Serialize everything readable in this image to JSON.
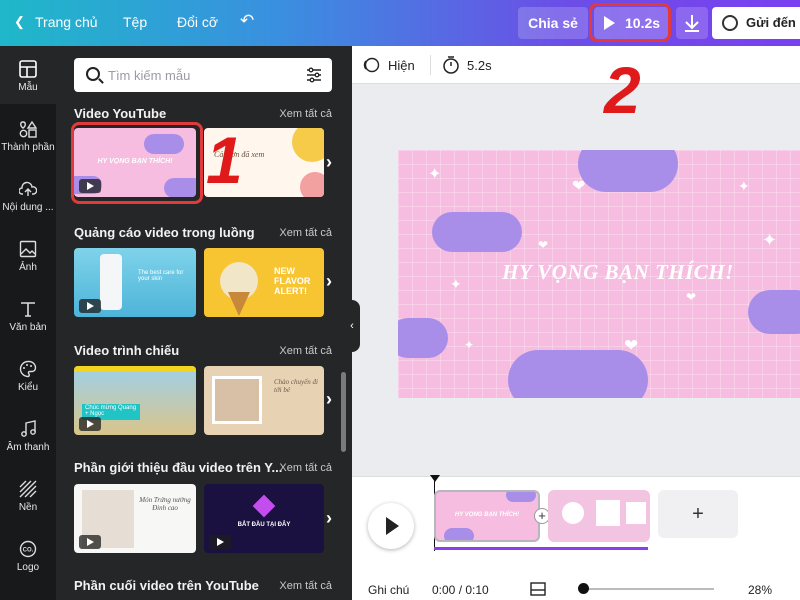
{
  "header": {
    "home": "Trang chủ",
    "file": "Tệp",
    "resize": "Đổi cỡ",
    "share": "Chia sẻ",
    "play_duration": "10.2s",
    "send": "Gửi đến g"
  },
  "nav": [
    {
      "label": "Mẫu",
      "icon": "layout-icon"
    },
    {
      "label": "Thành phần",
      "icon": "shapes-icon"
    },
    {
      "label": "Nội dung ...",
      "icon": "cloud-upload-icon"
    },
    {
      "label": "Ảnh",
      "icon": "image-icon"
    },
    {
      "label": "Văn bản",
      "icon": "text-icon"
    },
    {
      "label": "Kiểu",
      "icon": "palette-icon"
    },
    {
      "label": "Âm thanh",
      "icon": "music-note-icon"
    },
    {
      "label": "Nền",
      "icon": "stripes-icon"
    },
    {
      "label": "Logo",
      "icon": "logo-icon"
    }
  ],
  "search": {
    "placeholder": "Tìm kiếm mẫu"
  },
  "see_all": "Xem tất cả",
  "sections": [
    {
      "title": "Video YouTube"
    },
    {
      "title": "Quảng cáo video trong luồng"
    },
    {
      "title": "Video trình chiếu"
    },
    {
      "title": "Phần giới thiệu đầu video trên Y..."
    },
    {
      "title": "Phần cuối video trên YouTube"
    }
  ],
  "thumbs": {
    "t1": "HY VỌNG BẠN THÍCH!",
    "t2": "Cảm ơn đã xem",
    "t3a": "The best care for your skin",
    "t4": "NEW FLAVOR ALERT!",
    "t5": "Chúc mừng Quang + Ngọc",
    "t6": "Chào chuyến đi tới bé",
    "t7": "Món Trứng nướng Đinh cao",
    "t8": "BẮT ĐẦU TẠI ĐÂY"
  },
  "toolbar": {
    "show": "Hiện",
    "time": "5.2s"
  },
  "canvas": {
    "title": "HY VỌNG BẠN THÍCH!"
  },
  "timeline": {
    "clip1": "HY VỌNG BẠN THÍCH!",
    "notes": "Ghi chú",
    "time": "0:00 / 0:10",
    "zoom": "28%"
  },
  "annotations": {
    "one": "1",
    "two": "2"
  },
  "colors": {
    "highlight": "#e23a3a",
    "accent": "#8b3df0",
    "canvas_bg": "#f6bde0",
    "cloud": "#a98ee9"
  }
}
